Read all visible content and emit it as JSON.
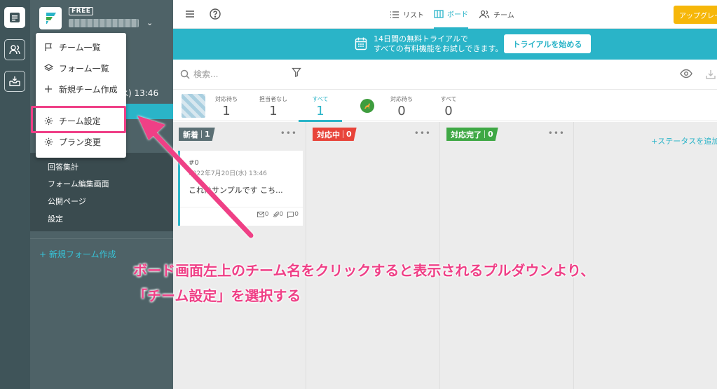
{
  "sidebar": {
    "free_badge": "FREE",
    "date_text": "水) 13:46",
    "items": [
      {
        "label": "回答集計"
      },
      {
        "label": "フォーム編集画面"
      },
      {
        "label": "公開ページ"
      },
      {
        "label": "設定"
      }
    ],
    "new_form": "+ 新規フォーム作成"
  },
  "dropdown": {
    "items": [
      {
        "label": "チーム一覧",
        "icon": "flag-icon"
      },
      {
        "label": "フォーム一覧",
        "icon": "layers-icon"
      },
      {
        "label": "新規チーム作成",
        "icon": "plus-icon"
      },
      {
        "label": "チーム設定",
        "icon": "gear-icon"
      },
      {
        "label": "プラン変更",
        "icon": "gear-icon"
      }
    ]
  },
  "topbar": {
    "tabs": [
      {
        "label": "リスト",
        "icon": "list-icon"
      },
      {
        "label": "ボード",
        "icon": "board-icon",
        "active": true
      },
      {
        "label": "チーム",
        "icon": "users-icon"
      }
    ],
    "upgrade": "アップグレード"
  },
  "banner": {
    "line1": "14日間の無料トライアルで",
    "line2": "すべての有料機能をお試しできます。",
    "button": "トライアルを始める"
  },
  "search": {
    "placeholder": "検索..."
  },
  "counters": [
    {
      "label": "対応待ち",
      "value": "1"
    },
    {
      "label": "担当者なし",
      "value": "1"
    },
    {
      "label": "すべて",
      "value": "1",
      "active": true
    },
    {
      "label": "対応待ち",
      "value": "0"
    },
    {
      "label": "すべて",
      "value": "0"
    }
  ],
  "columns": [
    {
      "title": "新着",
      "count": "1",
      "color": "#5b6f74"
    },
    {
      "title": "対応中",
      "count": "0",
      "color": "#e8443a"
    },
    {
      "title": "対応完了",
      "count": "0",
      "color": "#3fa845"
    }
  ],
  "add_status": "+ステータスを追加",
  "card": {
    "id": "#0",
    "date": "2022年7月20日(水) 13:46",
    "title": "これはサンプルです こち...",
    "mail_count": "0",
    "attach_count": "0",
    "comment_count": "0"
  },
  "annotation": {
    "line1": "ボード画面左上のチーム名をクリックすると表示されるプルダウンより、",
    "line2": "「チーム設定」を選択する",
    "color": "#ef3f86"
  }
}
